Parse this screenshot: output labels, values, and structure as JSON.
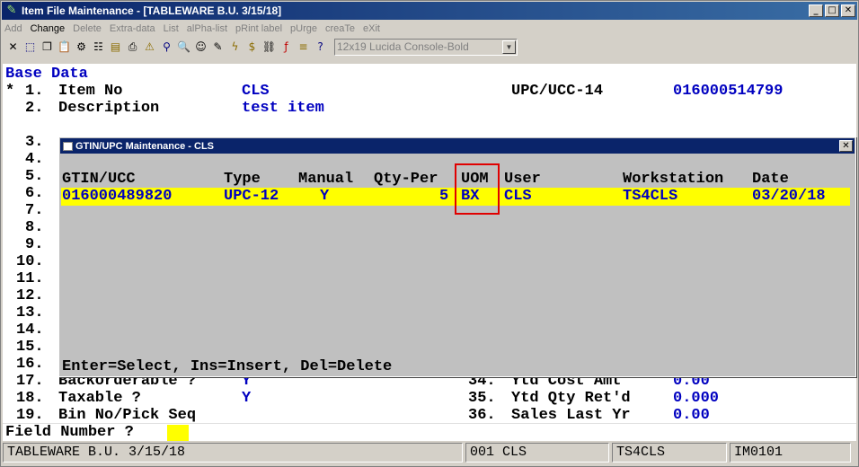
{
  "window": {
    "title": "Item File Maintenance - [TABLEWARE B.U. 3/15/18]",
    "minimize": "_",
    "maximize": "□",
    "close": "✕"
  },
  "menu": [
    {
      "label": "Add",
      "active": false
    },
    {
      "label": "Change",
      "active": true
    },
    {
      "label": "Delete",
      "active": false
    },
    {
      "label": "Extra-data",
      "active": false
    },
    {
      "label": "List",
      "active": false
    },
    {
      "label": "alPha-list",
      "active": false
    },
    {
      "label": "pRint label",
      "active": false
    },
    {
      "label": "pUrge",
      "active": false
    },
    {
      "label": "creaTe",
      "active": false
    },
    {
      "label": "eXit",
      "active": false
    }
  ],
  "toolbar": {
    "font_value": "12x19 Lucida Console-Bold",
    "icons": [
      "close-x-icon",
      "select-icon",
      "copy-icon",
      "paste-icon",
      "settings-icon",
      "properties-icon",
      "notes-icon",
      "print-icon",
      "alert-icon",
      "find-icon",
      "zoom-icon",
      "user-icon",
      "edit-icon",
      "lightning-icon",
      "money-icon",
      "link-icon",
      "function-icon",
      "list-icon",
      "help-icon"
    ]
  },
  "terminal": {
    "section": "Base Data",
    "rows": [
      {
        "marker": "*",
        "num": "1.",
        "label": "Item No",
        "value": "CLS",
        "rlabel": "UPC/UCC-14",
        "rvalue": "016000514799"
      },
      {
        "marker": "",
        "num": "2.",
        "label": "Description",
        "value": "test item",
        "rlabel": "",
        "rvalue": ""
      }
    ],
    "nums": [
      "3.",
      "4.",
      "5.",
      "6.",
      "7.",
      "8.",
      "9.",
      "10.",
      "11.",
      "12.",
      "13.",
      "14.",
      "15.",
      "16."
    ],
    "bottom_rows": [
      {
        "num": "17.",
        "label": "Backorderable ?",
        "value": "Y",
        "rnum": "34.",
        "rlabel": "Ytd Cost Amt",
        "rvalue": "0.00"
      },
      {
        "num": "18.",
        "label": "Taxable ?",
        "value": "Y",
        "rnum": "35.",
        "rlabel": "Ytd Qty Ret'd",
        "rvalue": "0.000"
      },
      {
        "num": "19.",
        "label": "Bin No/Pick Seq",
        "value": "",
        "rnum": "36.",
        "rlabel": "Sales Last Yr",
        "rvalue": "0.00"
      }
    ],
    "prompt": "Field Number ?"
  },
  "dialog": {
    "title": "GTIN/UPC Maintenance - CLS",
    "close": "✕",
    "headers": [
      "GTIN/UCC",
      "Type",
      "Manual",
      "Qty-Per",
      "UOM",
      "User",
      "Workstation",
      "Date"
    ],
    "row": [
      "016000489820",
      "UPC-12",
      "Y",
      "5",
      "BX",
      "CLS",
      "TS4CLS",
      "03/20/18"
    ],
    "footer": "Enter=Select, Ins=Insert, Del=Delete"
  },
  "status": {
    "company": "TABLEWARE B.U. 3/15/18",
    "user": "001 CLS",
    "workstation": "TS4CLS",
    "program": "IM0101"
  }
}
